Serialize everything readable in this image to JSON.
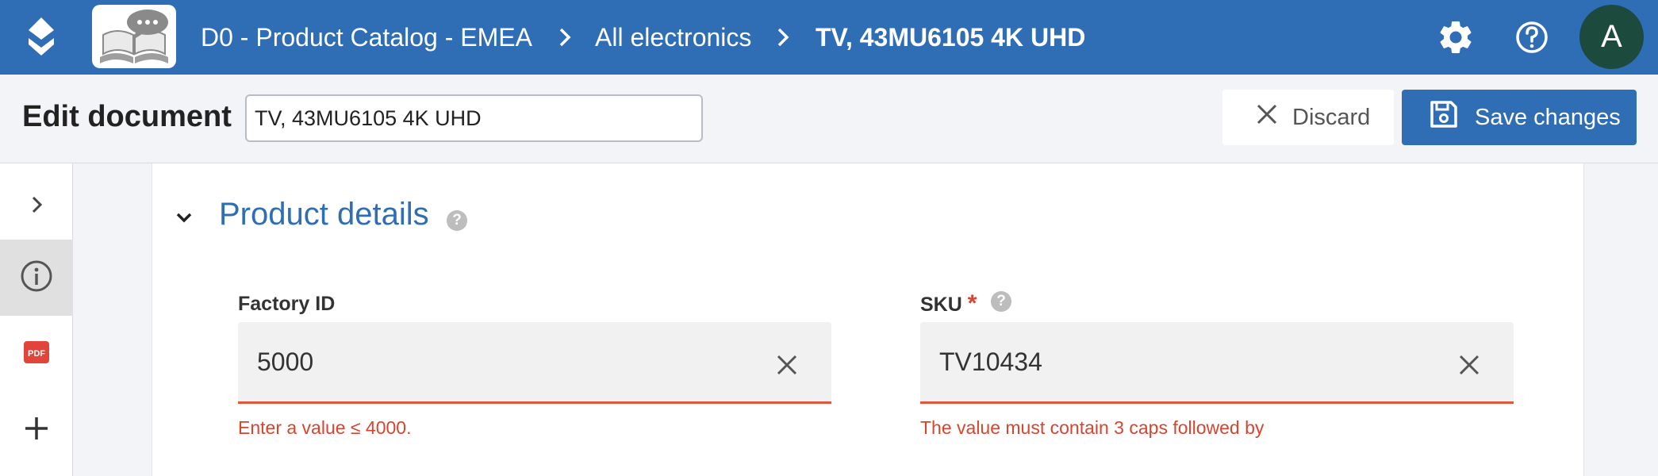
{
  "header": {
    "breadcrumb": [
      "D0 - Product Catalog - EMEA",
      "All electronics",
      "TV, 43MU6105 4K UHD"
    ],
    "avatar_initial": "A",
    "icons": [
      "app-logo-icon",
      "gear-icon",
      "help-circle-icon"
    ]
  },
  "editbar": {
    "title": "Edit document",
    "name_value": "TV, 43MU6105 4K UHD",
    "discard_label": "Discard",
    "save_label": "Save changes"
  },
  "siderail": {
    "items": [
      "chevron-right-icon",
      "info-icon",
      "pdf-icon",
      "plus-icon"
    ],
    "pdf_text": "PDF"
  },
  "section": {
    "title": "Product details",
    "help": "?"
  },
  "fields": {
    "factory_id": {
      "label": "Factory ID",
      "value": "5000",
      "error": "Enter a value ≤ 4000."
    },
    "sku": {
      "label": "SKU",
      "required_mark": "*",
      "help": "?",
      "value": "TV10434",
      "error": "The value must contain 3 caps followed by"
    }
  },
  "colors": {
    "brand": "#2f6db5",
    "error": "#d9442f",
    "avatar": "#1c4a3d"
  }
}
